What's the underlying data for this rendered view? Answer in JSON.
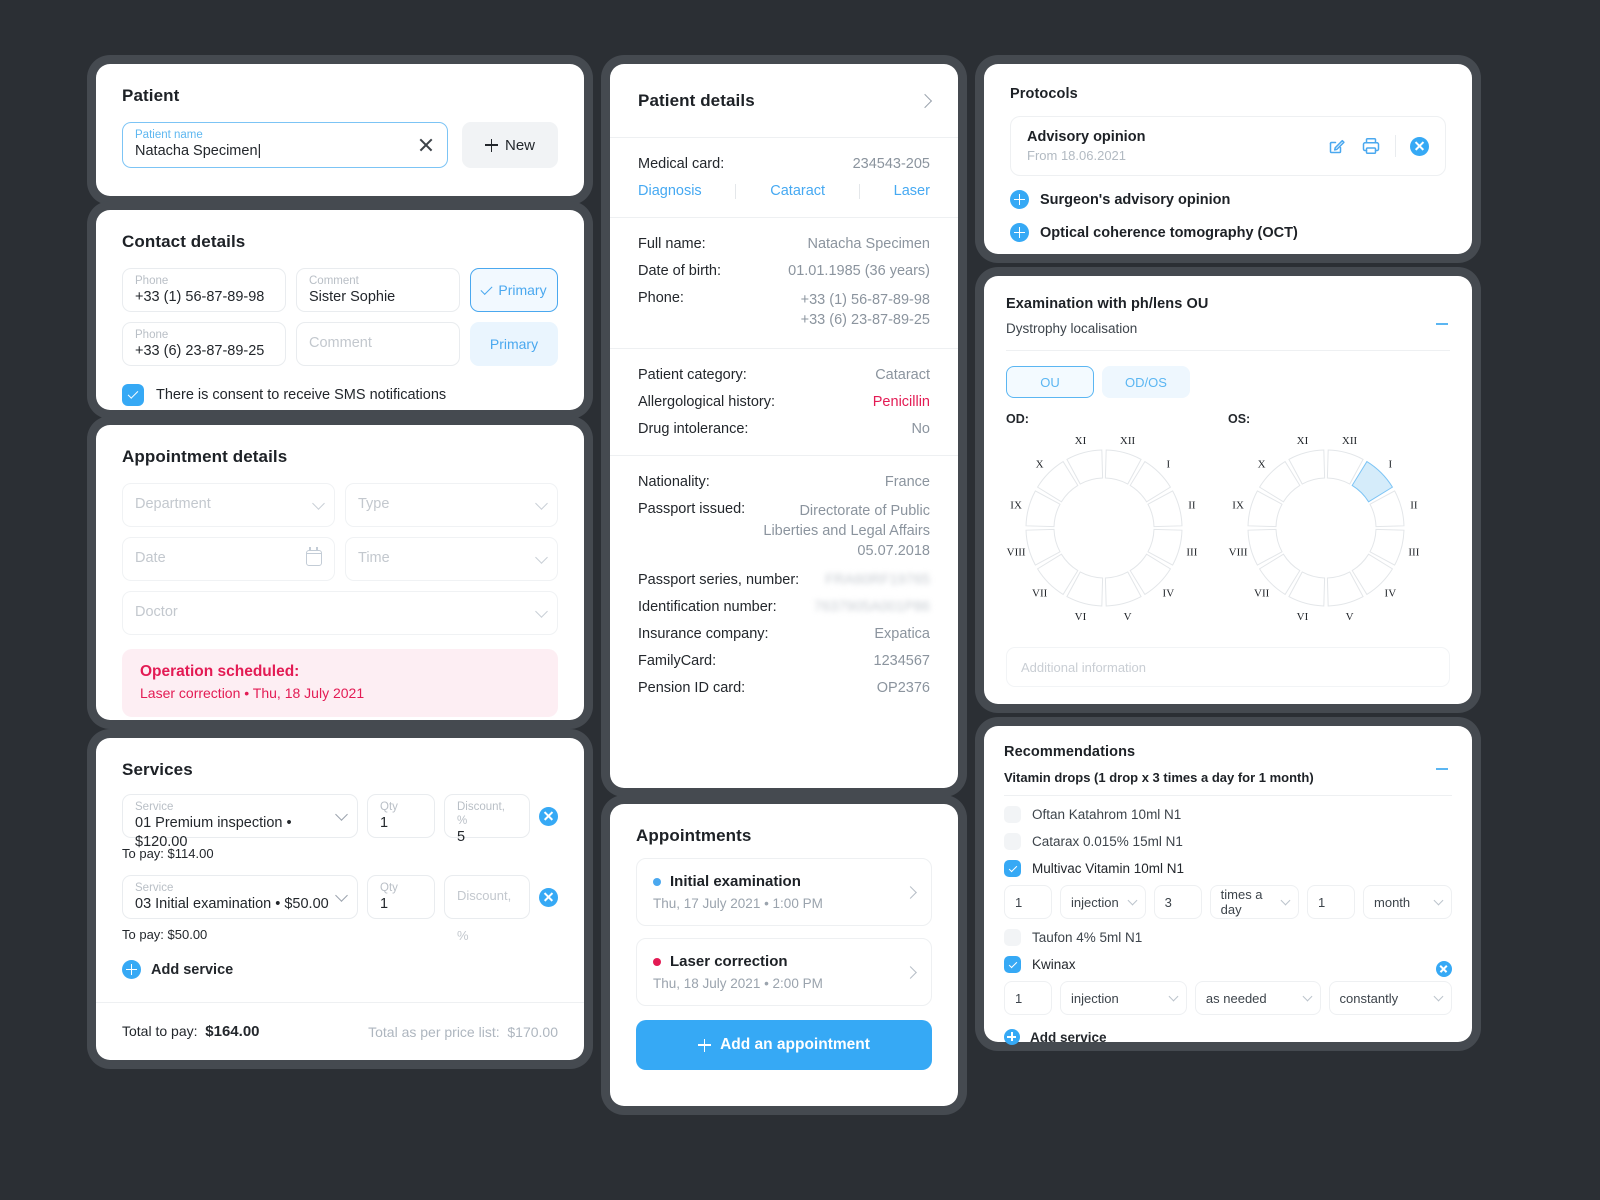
{
  "patient": {
    "title": "Patient",
    "name_label": "Patient name",
    "name_value": "Natacha Specimen",
    "new_button": "New"
  },
  "contact": {
    "title": "Contact details",
    "rows": [
      {
        "phone_label": "Phone",
        "phone_value": "+33 (1) 56-87-89-98",
        "comment_label": "Comment",
        "comment_value": "Sister Sophie",
        "primary_label": "Primary",
        "primary_active": true
      },
      {
        "phone_label": "Phone",
        "phone_value": "+33 (6) 23-87-89-25",
        "comment_label": "Comment",
        "comment_value": "",
        "comment_placeholder": "Comment",
        "primary_label": "Primary",
        "primary_active": false
      }
    ],
    "consent_text": "There is consent to receive SMS notifications",
    "consent_checked": true
  },
  "appointment_details": {
    "title": "Appointment details",
    "department_placeholder": "Department",
    "type_placeholder": "Type",
    "date_placeholder": "Date",
    "time_placeholder": "Time",
    "doctor_placeholder": "Doctor",
    "banner_title": "Operation scheduled:",
    "banner_text": "Laser correction • Thu, 18 July 2021"
  },
  "services": {
    "title": "Services",
    "items": [
      {
        "service_label": "Service",
        "service_value": "01 Premium inspection • $120.00",
        "qty_label": "Qty",
        "qty_value": "1",
        "discount_label": "Discount, %",
        "discount_value": "5",
        "discount_placeholder": "",
        "to_pay": "To pay: $114.00"
      },
      {
        "service_label": "Service",
        "service_value": "03 Initial examination • $50.00",
        "qty_label": "Qty",
        "qty_value": "1",
        "discount_label": "",
        "discount_value": "",
        "discount_placeholder": "Discount, %",
        "to_pay": "To pay: $50.00"
      }
    ],
    "add_label": "Add service",
    "total_label": "Total to pay:",
    "total_value": "$164.00",
    "pricelist_label": "Total as per price list:",
    "pricelist_value": "$170.00"
  },
  "patient_details": {
    "title": "Patient details",
    "medical_card_label": "Medical card:",
    "medical_card_value": "234543-205",
    "links": [
      "Diagnosis",
      "Cataract",
      "Laser"
    ],
    "section_basic": [
      {
        "key": "Full name:",
        "value": "Natacha Specimen"
      },
      {
        "key": "Date of birth:",
        "value": "01.01.1985 (36 years)"
      },
      {
        "key": "Phone:",
        "value": "+33 (1) 56-87-89-98\n+33 (6) 23-87-89-25"
      }
    ],
    "section_medical": [
      {
        "key": "Patient category:",
        "value": "Cataract",
        "style": "normal"
      },
      {
        "key": "Allergological history:",
        "value": "Penicillin",
        "style": "alert"
      },
      {
        "key": "Drug intolerance:",
        "value": "No",
        "style": "normal"
      }
    ],
    "section_docs": [
      {
        "key": "Nationality:",
        "value": "France",
        "style": "normal"
      },
      {
        "key": "Passport issued:",
        "value": "Directorate of Public\nLiberties and Legal Affairs\n05.07.2018",
        "style": "multi"
      },
      {
        "key": "Passport series, number:",
        "value": "FRA60RF19765",
        "style": "blur"
      },
      {
        "key": "Identification number:",
        "value": "7637905A001P86",
        "style": "blur"
      },
      {
        "key": "Insurance company:",
        "value": "Expatica",
        "style": "normal"
      },
      {
        "key": "FamilyCard:",
        "value": "1234567",
        "style": "normal"
      },
      {
        "key": "Pension ID card:",
        "value": "OP2376",
        "style": "normal"
      }
    ]
  },
  "appointments": {
    "title": "Appointments",
    "items": [
      {
        "name": "Initial examination",
        "when": "Thu, 17 July 2021 • 1:00 PM",
        "dot_color": "#4aa8ef"
      },
      {
        "name": "Laser correction",
        "when": "Thu, 18 July 2021 • 2:00 PM",
        "dot_color": "#e31b54"
      }
    ],
    "add_button": "Add an appointment"
  },
  "protocols": {
    "title": "Protocols",
    "item": {
      "name": "Advisory opinion",
      "date": "From 18.06.2021"
    },
    "actions": [
      "edit-icon",
      "print-icon",
      "delete-icon"
    ],
    "add_items": [
      "Surgeon's advisory opinion",
      "Optical coherence tomography (OCT)"
    ]
  },
  "examination": {
    "title": "Examination with ph/lens OU",
    "subtitle": "Dystrophy localisation",
    "tabs": [
      {
        "label": "OU",
        "active": true
      },
      {
        "label": "OD/OS",
        "active": false
      }
    ],
    "eyes": [
      {
        "label": "OD:",
        "highlighted": []
      },
      {
        "label": "OS:",
        "highlighted": [
          "I"
        ]
      }
    ],
    "hours": [
      "XII",
      "I",
      "II",
      "III",
      "IV",
      "V",
      "VI",
      "VII",
      "VIII",
      "IX",
      "X",
      "XI"
    ],
    "additional_placeholder": "Additional information",
    "highlight_color": "#d5ecfa"
  },
  "recommendations": {
    "title": "Recommendations",
    "subtitle": "Vitamin drops (1 drop x 3 times a day for 1 month)",
    "items": [
      {
        "name": "Oftan Katahrom 10ml N1",
        "checked": false,
        "dose": null
      },
      {
        "name": "Catarax 0.015% 15ml N1",
        "checked": false,
        "dose": null
      },
      {
        "name": "Multivac Vitamin 10ml N1",
        "checked": true,
        "dose": {
          "layout": "six",
          "amount": "1",
          "form": "injection",
          "freq_num": "3",
          "freq": "times a day",
          "dur_num": "1",
          "dur": "month"
        }
      },
      {
        "name": "Taufon 4% 5ml N1",
        "checked": false,
        "dose": null
      },
      {
        "name": "Kwinax",
        "checked": true,
        "dose": {
          "layout": "four",
          "amount": "1",
          "form": "injection",
          "freq": "as needed",
          "dur": "constantly"
        }
      }
    ],
    "add_label": "Add service"
  },
  "colors": {
    "accent": "#36a9f5",
    "link": "#46a9f2",
    "alert": "#e31b54",
    "background": "#2b2f34",
    "card_ring": "#454a50"
  }
}
